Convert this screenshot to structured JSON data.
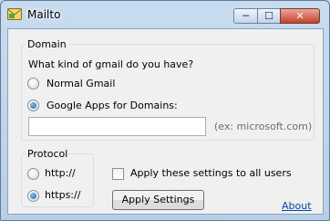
{
  "window": {
    "title": "Mailto",
    "controls": {
      "minimize": "─",
      "maximize": "☐",
      "close": "✕"
    },
    "icon": "mail-envelope-icon"
  },
  "domain": {
    "legend": "Domain",
    "question": "What kind of gmail do you have?",
    "options": [
      {
        "label": "Normal Gmail",
        "selected": false
      },
      {
        "label": "Google Apps for Domains:",
        "selected": true
      }
    ],
    "domain_input": {
      "value": "",
      "hint": "(ex: microsoft.com)"
    }
  },
  "protocol": {
    "legend": "Protocol",
    "options": [
      {
        "label": "http://",
        "selected": false
      },
      {
        "label": "https://",
        "selected": true
      }
    ]
  },
  "apply_all": {
    "label": "Apply these settings to all users",
    "checked": false
  },
  "buttons": {
    "apply": "Apply Settings"
  },
  "links": {
    "about": "About"
  },
  "colors": {
    "accent": "#1a5fb4",
    "link": "#0645ad",
    "frame": "#c9d9ea"
  }
}
